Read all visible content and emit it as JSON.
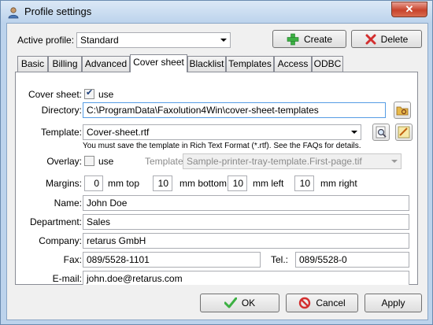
{
  "window": {
    "title": "Profile settings",
    "close_label": "✕"
  },
  "profile": {
    "label": "Active profile:",
    "value": "Standard",
    "create_label": "Create",
    "delete_label": "Delete"
  },
  "tabs": [
    {
      "label": "Basic"
    },
    {
      "label": "Billing"
    },
    {
      "label": "Advanced"
    },
    {
      "label": "Cover sheet"
    },
    {
      "label": "Blacklist"
    },
    {
      "label": "Templates"
    },
    {
      "label": "Access"
    },
    {
      "label": "ODBC"
    }
  ],
  "active_tab": "Cover sheet",
  "cover_sheet": {
    "cover_label": "Cover sheet:",
    "use_label": "use",
    "use_checked": true,
    "directory_label": "Directory:",
    "directory_value": "C:\\ProgramData\\Faxolution4Win\\cover-sheet-templates",
    "template_label": "Template:",
    "template_value": "Cover-sheet.rtf",
    "template_hint": "You must save the template in Rich Text Format (*.rtf). See the FAQs for details.",
    "overlay_label": "Overlay:",
    "overlay_use_label": "use",
    "overlay_checked": false,
    "overlay_template_label": "Template:",
    "overlay_template_value": "Sample-printer-tray-template.First-page.tif",
    "margins_label": "Margins:",
    "margin_top": "0",
    "margin_top_label": "mm top",
    "margin_bottom": "10",
    "margin_bottom_label": "mm bottom",
    "margin_left": "10",
    "margin_left_label": "mm left",
    "margin_right": "10",
    "margin_right_label": "mm right",
    "name_label": "Name:",
    "name_value": "John Doe",
    "department_label": "Department:",
    "department_value": "Sales",
    "company_label": "Company:",
    "company_value": "retarus GmbH",
    "fax_label": "Fax:",
    "fax_value": "089/5528-1101",
    "tel_label": "Tel.:",
    "tel_value": "089/5528-0",
    "email_label": "E-mail:",
    "email_value": "john.doe@retarus.com"
  },
  "footer": {
    "ok_label": "OK",
    "cancel_label": "Cancel",
    "apply_label": "Apply"
  },
  "colors": {
    "create_icon": "#3cb043",
    "delete_icon": "#d32f2f",
    "ok_icon": "#3cb043",
    "cancel_icon": "#d32f2f"
  }
}
